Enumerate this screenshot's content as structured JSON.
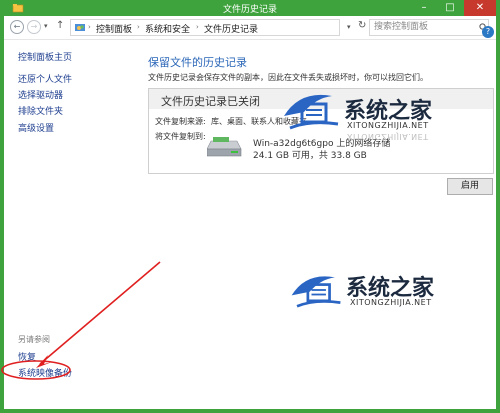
{
  "window": {
    "title": "文件历史记录",
    "accent": "#3fa33d"
  },
  "navbar": {
    "breadcrumb": [
      "控制面板",
      "系统和安全",
      "文件历史记录"
    ],
    "search_placeholder": "搜索控制面板"
  },
  "sidebar": {
    "top_links": [
      "控制面板主页"
    ],
    "links": [
      "还原个人文件",
      "选择驱动器",
      "排除文件夹",
      "高级设置"
    ],
    "see_also_heading": "另请参阅",
    "see_also_links": [
      "恢复",
      "系统映像备份"
    ]
  },
  "main": {
    "heading": "保留文件的历史记录",
    "description": "文件历史记录会保存文件的副本，因此在文件丢失或损坏时，你可以找回它们。",
    "panel_title": "文件历史记录已关闭",
    "copy_from_label": "文件复制来源:",
    "copy_from_value": "库、桌面、联系人和收藏夹",
    "copy_to_label": "将文件复制到:",
    "drive_name": "Win-a32dg6t6gpo 上的网络存储",
    "drive_space": "24.1 GB 可用，共 33.8 GB",
    "enable_button": "启用"
  },
  "watermark": {
    "brand": "系统之家",
    "url": "XITONGZHIJIA.NET"
  },
  "icons": [
    "back-icon",
    "forward-icon",
    "up-icon",
    "refresh-icon",
    "search-icon",
    "help-icon",
    "drive-icon",
    "control-panel-icon"
  ]
}
